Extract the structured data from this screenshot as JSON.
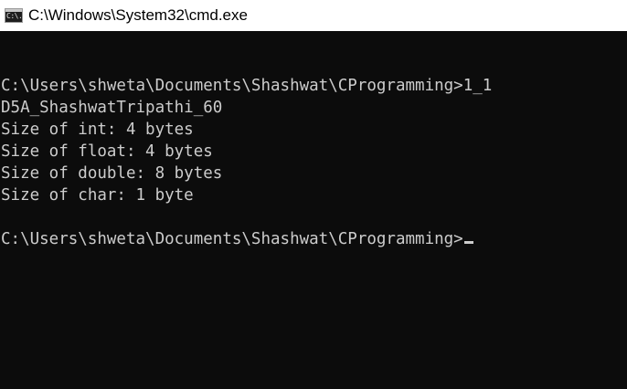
{
  "window": {
    "title": "C:\\Windows\\System32\\cmd.exe",
    "icon": "cmd-icon",
    "icon_glyph": "C:\\."
  },
  "colors": {
    "console_background": "#0c0c0c",
    "console_text": "#cccccc",
    "titlebar_background": "#ffffff"
  },
  "console": {
    "lines": [
      "",
      "C:\\Users\\shweta\\Documents\\Shashwat\\CProgramming>1_1",
      "D5A_ShashwatTripathi_60",
      "Size of int: 4 bytes",
      "Size of float: 4 bytes",
      "Size of double: 8 bytes",
      "Size of char: 1 byte",
      "",
      "C:\\Users\\shweta\\Documents\\Shashwat\\CProgramming>"
    ]
  }
}
